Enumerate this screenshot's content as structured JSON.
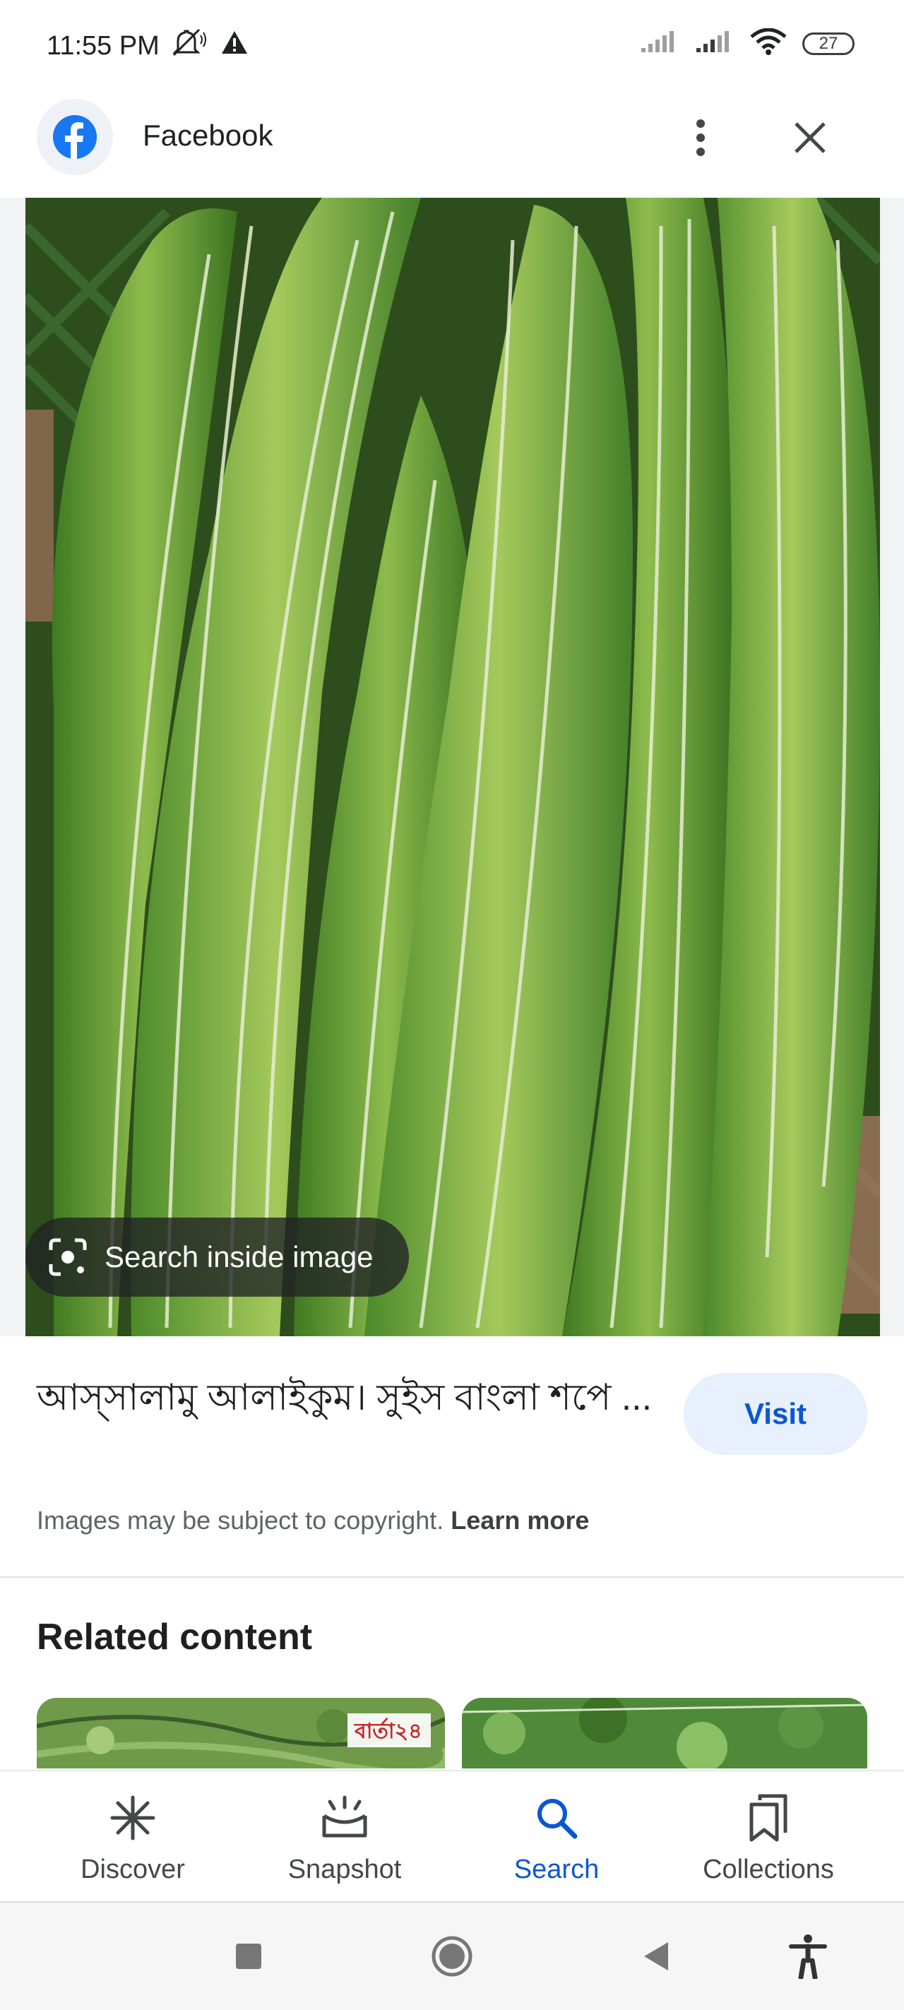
{
  "status_bar": {
    "time": "11:55 PM",
    "battery": "27",
    "icons": [
      "mute-icon",
      "alert-icon",
      "signal-icon",
      "signal-icon",
      "wifi-icon",
      "battery-icon"
    ]
  },
  "header": {
    "source_name": "Facebook",
    "logo_icon": "facebook-logo",
    "more_icon": "more-vert-icon",
    "close_icon": "close-icon"
  },
  "image": {
    "search_inside_label": "Search inside image",
    "search_inside_icon": "lens-icon"
  },
  "result": {
    "title": "আস্সালামু আলাইকুম। সুইস বাংলা শপে ...",
    "visit_label": "Visit",
    "copyright_text": "Images may be subject to copyright.",
    "learn_more": "Learn more"
  },
  "related": {
    "title": "Related content",
    "thumb_text": "বার্তা২৪"
  },
  "bottom_nav": {
    "items": [
      {
        "label": "Discover",
        "icon": "asterisk-icon"
      },
      {
        "label": "Snapshot",
        "icon": "snapshot-icon"
      },
      {
        "label": "Search",
        "icon": "search-icon",
        "active": true
      },
      {
        "label": "Collections",
        "icon": "bookmarks-icon"
      }
    ]
  },
  "system_nav": {
    "icons": [
      "recents-icon",
      "home-icon",
      "back-icon",
      "accessibility-icon"
    ]
  },
  "colors": {
    "accent": "#0b57d0",
    "visit_bg": "#e8effd",
    "facebook_blue": "#1877f2"
  }
}
